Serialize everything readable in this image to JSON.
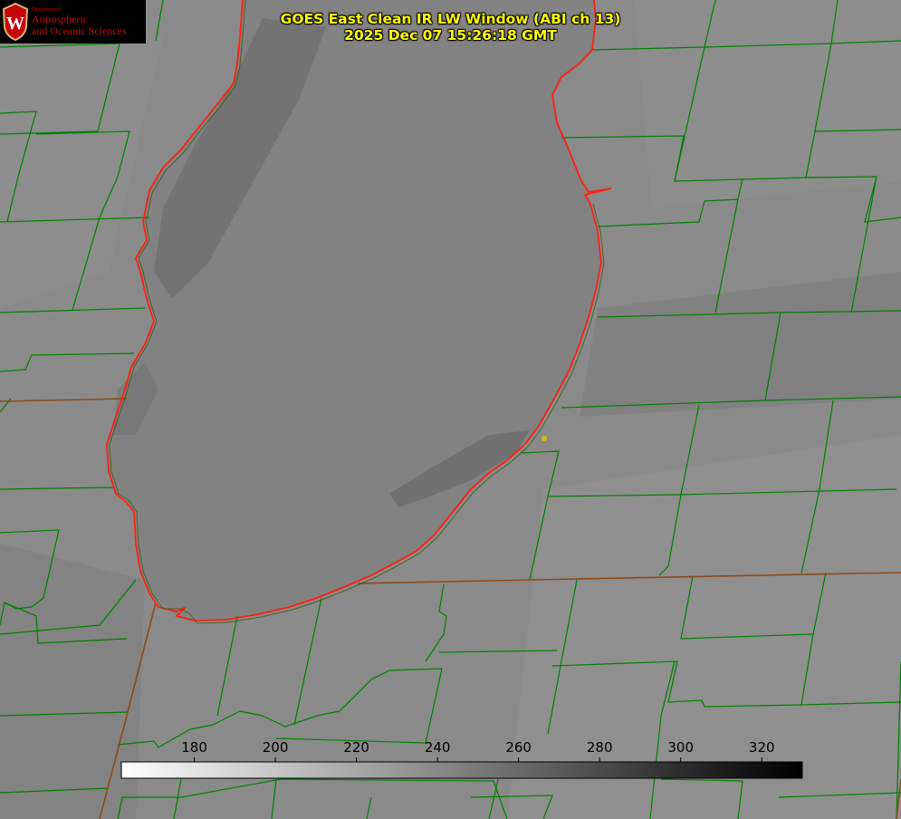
{
  "title": {
    "line1": "GOES East Clean IR LW Window (ABI ch 13)",
    "line2": "2025 Dec 07 15:26:18 GMT"
  },
  "logo": {
    "department": "Department of",
    "line1": "Atmospheric",
    "line2": "and Oceanic Sciences",
    "seal_letter": "W"
  },
  "colorbar": {
    "ticks": [
      "180",
      "200",
      "220",
      "240",
      "260",
      "280",
      "300",
      "320"
    ],
    "min_value": 162,
    "max_value": 330,
    "gradient": "white-to-black"
  },
  "colors": {
    "county_lines": "#008000",
    "shoreline": "#ff2010",
    "state_lines": "#8b4a1c",
    "title": "#ffff00",
    "marker": "#d4c000",
    "logo_red": "#c5050c"
  },
  "icons": [
    "uw-seal-icon",
    "station-marker-icon"
  ]
}
